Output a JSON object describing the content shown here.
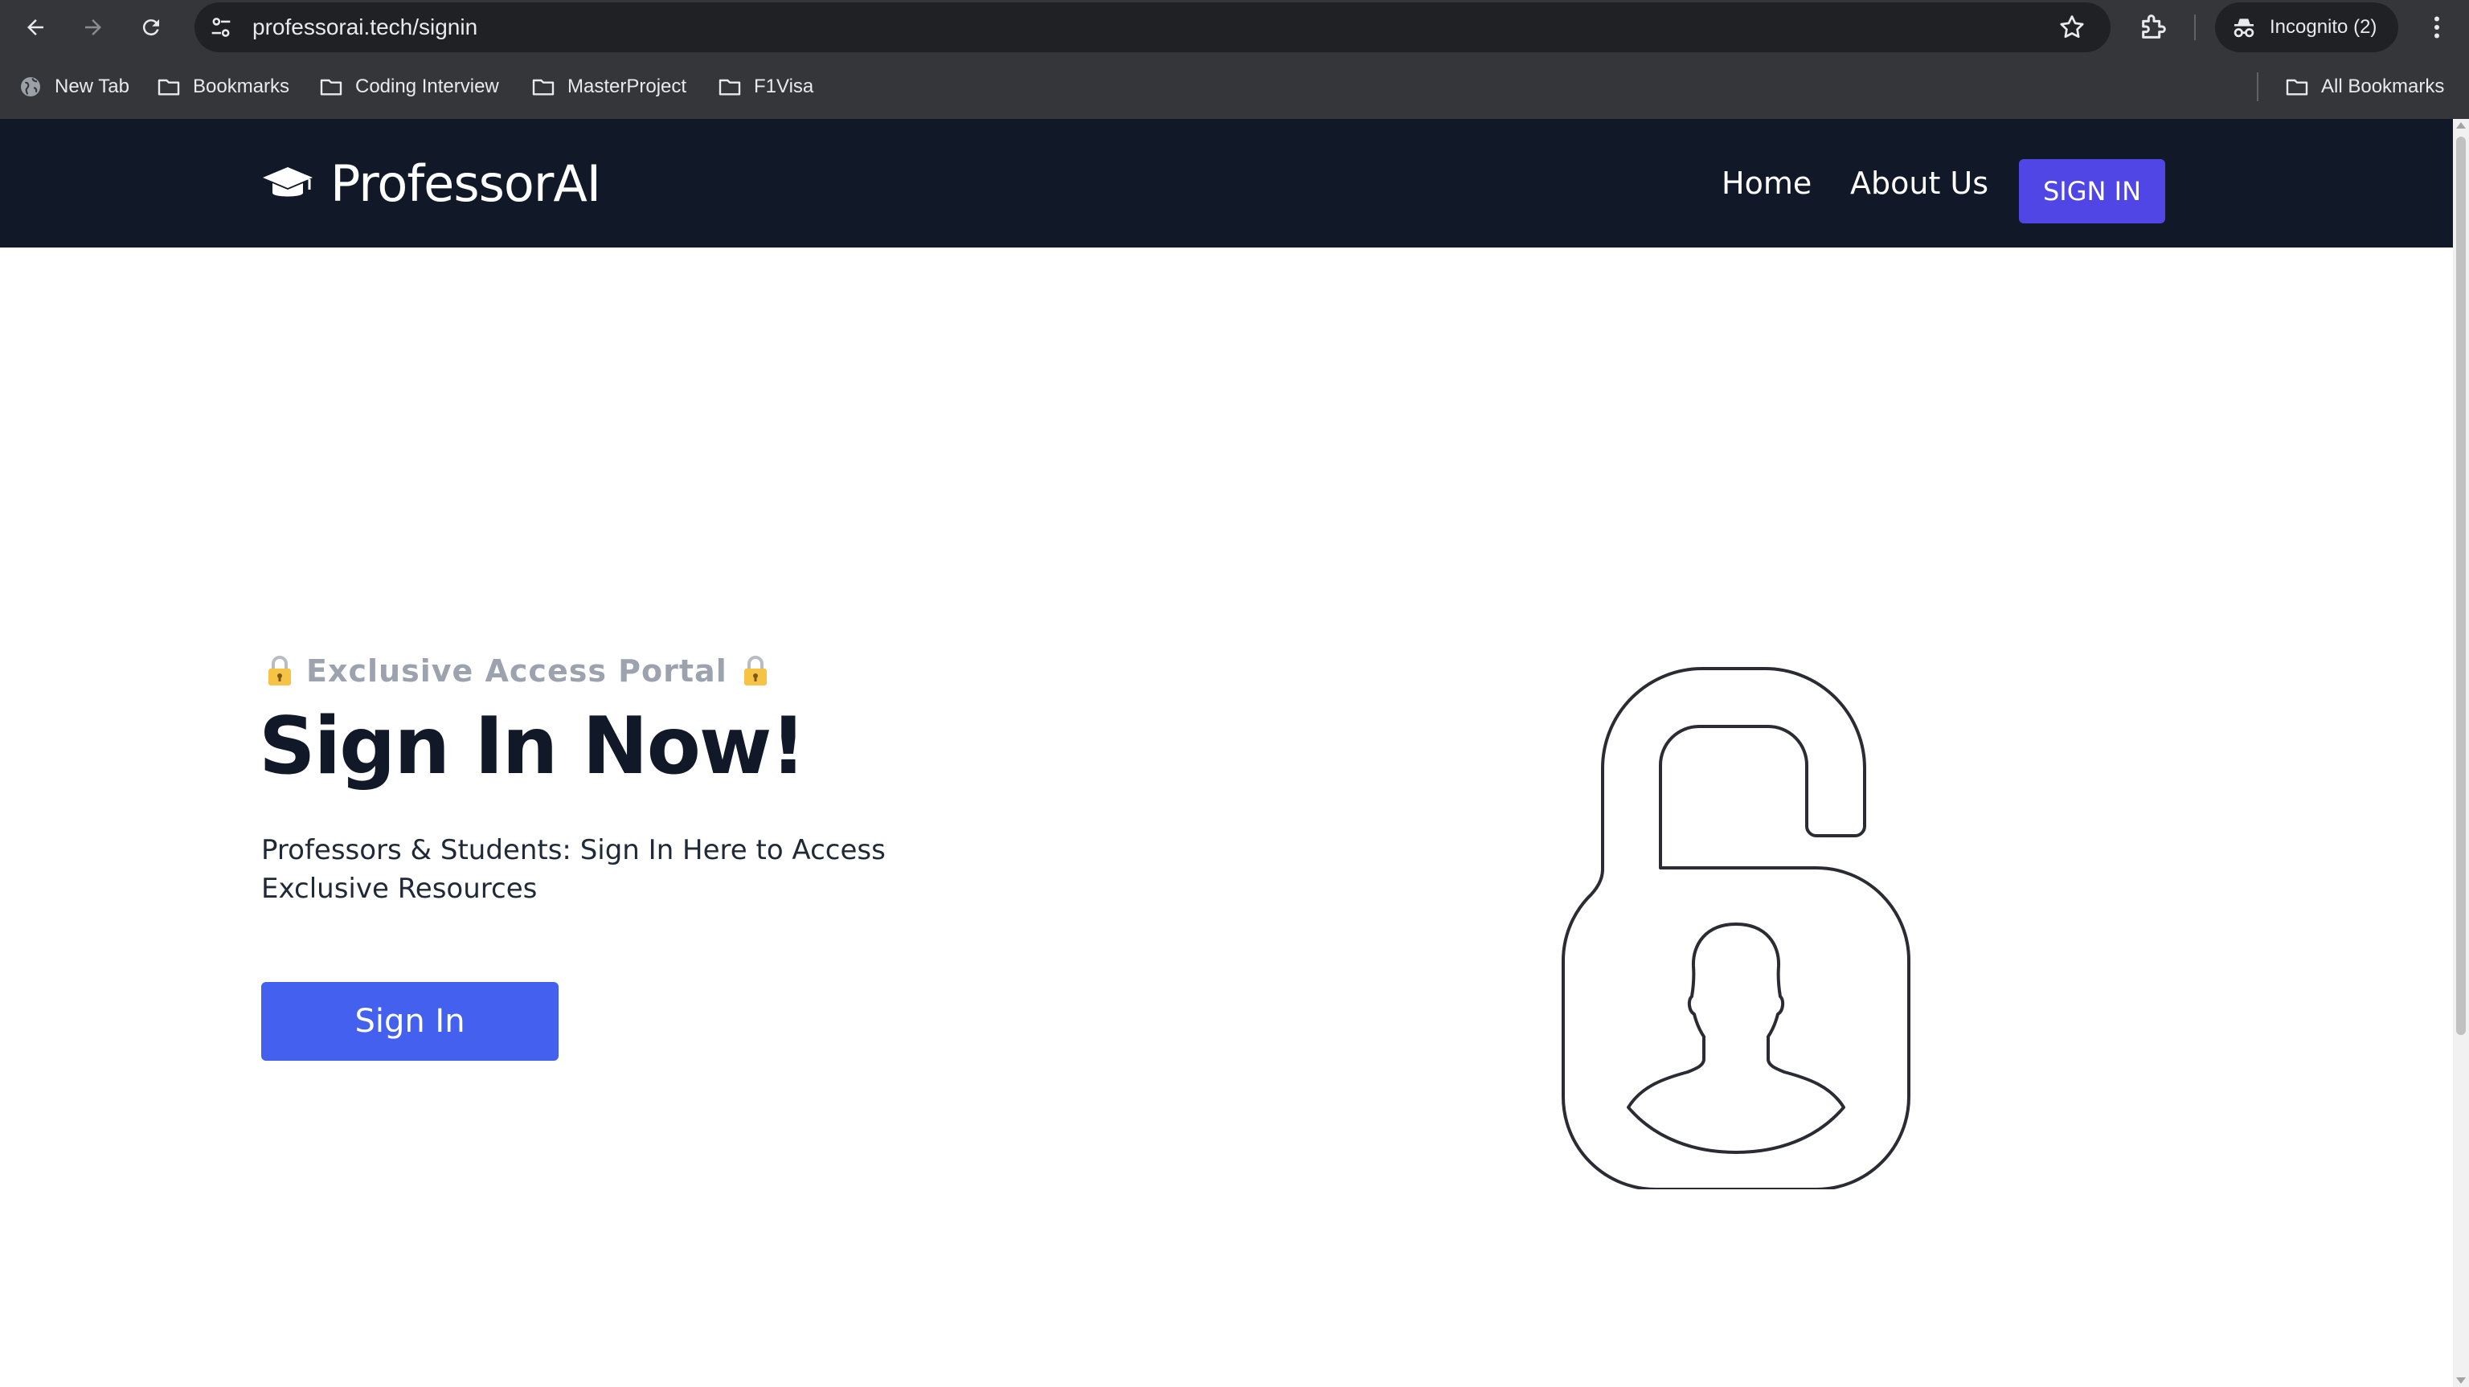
{
  "browser": {
    "url": "professorai.tech/signin",
    "incognito_label": "Incognito (2)",
    "bookmarks": [
      {
        "label": "New Tab",
        "icon": "globe-icon"
      },
      {
        "label": "Bookmarks",
        "icon": "folder-icon"
      },
      {
        "label": "Coding Interview",
        "icon": "folder-icon"
      },
      {
        "label": "MasterProject",
        "icon": "folder-icon"
      },
      {
        "label": "F1Visa",
        "icon": "folder-icon"
      }
    ],
    "all_bookmarks": "All Bookmarks"
  },
  "header": {
    "brand": "ProfessorAI",
    "nav": [
      "Home",
      "About Us"
    ],
    "signin_label": "SIGN IN"
  },
  "hero": {
    "eyebrow": "Exclusive Access Portal",
    "title": "Sign In Now!",
    "subtitle": "Professors & Students: Sign In Here to Access Exclusive Resources",
    "cta_label": "Sign In"
  },
  "colors": {
    "header_bg": "#111827",
    "nav_button": "#4f46e5",
    "cta_button": "#4361ee",
    "browser_chrome": "#35363a"
  }
}
